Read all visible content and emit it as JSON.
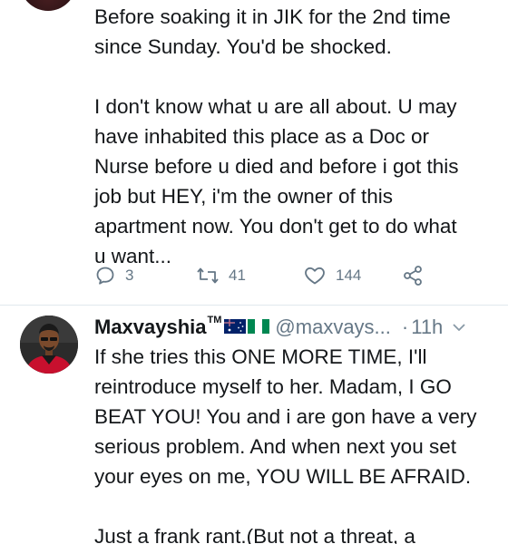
{
  "tweet1": {
    "lines": [
      "Before soaking it in JIK for the 2nd time",
      "since Sunday. You'd be shocked.",
      "",
      "I don't know what u are all about. U may",
      "have inhabited this place as a Doc or",
      "Nurse before u died and before i got this",
      "job but HEY, i'm the owner of this",
      "apartment now. You don't get to do what",
      "u want..."
    ],
    "actions": {
      "reply_count": "3",
      "retweet_count": "41",
      "like_count": "144"
    }
  },
  "tweet2": {
    "display_name": "Maxvayshia",
    "trademark": "TM",
    "handle": "@maxvays...",
    "separator": "·",
    "time": "11h",
    "lines": [
      "If she tries this ONE MORE TIME, I'll",
      "reintroduce myself to her. Madam, I GO",
      "BEAT YOU! You and i are gon have a very",
      "serious problem. And when next you set",
      "your eyes on me, YOU WILL BE AFRAID.",
      "",
      "Just a frank rant.(But not a threat, a"
    ]
  },
  "icons": {
    "reply": "reply-icon",
    "retweet": "retweet-icon",
    "like": "heart-icon",
    "share": "share-icon",
    "caret": "chevron-down-icon"
  },
  "colors": {
    "text": "#14171a",
    "muted": "#657786",
    "divider": "#e1e8ed"
  }
}
